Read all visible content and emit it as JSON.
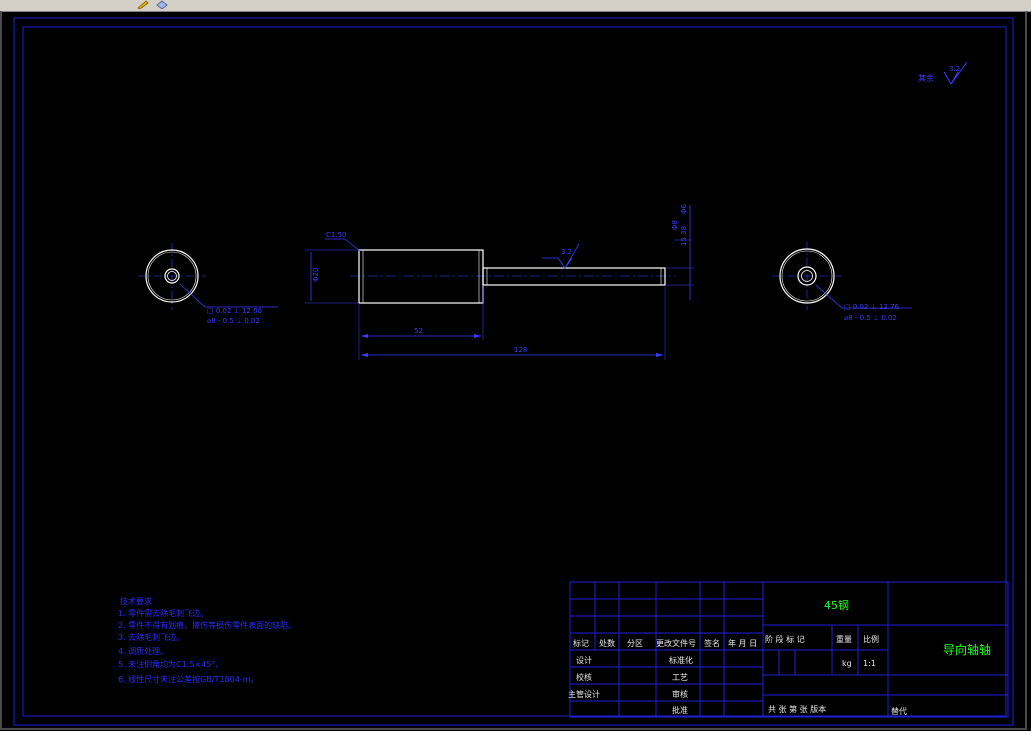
{
  "colors": {
    "background": "#000000",
    "frame": "#2121d8",
    "part": "#ffffff",
    "dimension": "#3c3cff",
    "title_text": "#22ff22",
    "notes_text": "#2b2bff",
    "table_text": "#e8e8e8"
  },
  "toolbar": {
    "icons": [
      "pencil-icon",
      "layer-cube-icon"
    ]
  },
  "drawing": {
    "surface_finish_label": "其余",
    "surface_finish_value": "3.2",
    "dim_chamfer_left": "C1.50",
    "dim_diameter_left": "Φ20",
    "dim_roughness_mid": "3.2",
    "dim_length_short": "52",
    "dim_length_total": "128",
    "dim_shaft_v1": "Φ8",
    "dim_shaft_v2": "15.38",
    "dim_shaft_v3": "Φ6",
    "tol_left_line1": "□ 0.02 ⊥ 12.00",
    "tol_left_line2": "⌀8 - 0.5 ⊥ 0.02",
    "tol_right_line1": "□ 0.02 ⊥ 12.76",
    "tol_right_line2": "⌀8 - 0.5 ⊥ 0.02"
  },
  "notes": {
    "title": "技术要求",
    "items": [
      "1. 零件需去除毛刺飞边。",
      "2. 零件不得有划痕、擦伤等损伤零件表面的缺陷。",
      "3. 去除毛刺飞边。",
      "4. 调质处理。",
      "5. 未注倒角均为C1.5×45°。",
      "6. 线性尺寸未注公差按GB/T1804-m。"
    ]
  },
  "title_block": {
    "material": "45钢",
    "part_name": "导向轴轴",
    "header_row": [
      "标记",
      "处数",
      "分区",
      "更改文件号",
      "签名",
      "年 月 日"
    ],
    "role_design": "设计",
    "role_standard": "标准化",
    "role_check": "校核",
    "role_process": "工艺",
    "role_chief": "主管设计",
    "role_review": "审核",
    "role_approve": "批准",
    "stage_label": "阶 段 标 记",
    "weight_label": "重量",
    "scale_label": "比例",
    "weight_unit": "kg",
    "scale_value": "1:1",
    "sheet_info": "共  张  第  张  版本",
    "replaces": "替代"
  }
}
